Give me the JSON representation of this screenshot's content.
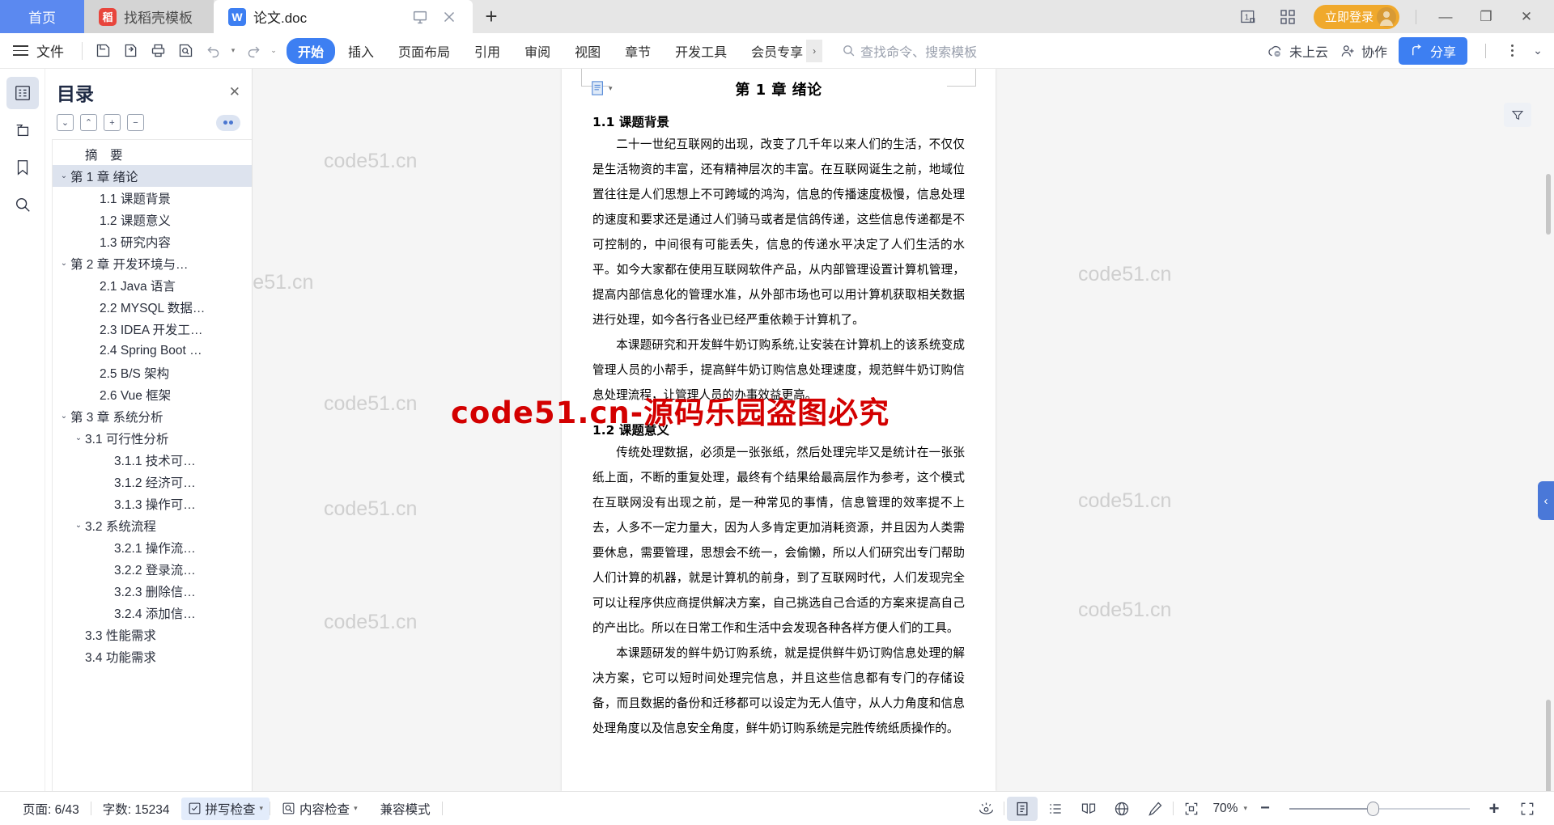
{
  "tabbar": {
    "tabs": [
      {
        "label": "首页",
        "icon": "",
        "type": "home"
      },
      {
        "label": "找稻壳模板",
        "icon": "docer-icon",
        "type": "docer"
      },
      {
        "label": "论文.doc",
        "icon": "wps-writer-icon",
        "type": "doc"
      }
    ],
    "doc_tab_actions": [
      "present-icon",
      "close-icon"
    ],
    "new_tab": "+",
    "right": {
      "page_count_icon": "1",
      "grid_icon": "apps-grid-icon",
      "login_label": "立即登录",
      "minimize": "—",
      "restore": "❐",
      "close": "✕"
    }
  },
  "ribbon": {
    "file_label": "文件",
    "quick_access": [
      "save-icon",
      "save-as-cloud-icon",
      "print-icon",
      "print-preview-icon",
      "undo-icon",
      "redo-icon"
    ],
    "tabs": [
      {
        "label": "开始",
        "active": true
      },
      {
        "label": "插入",
        "active": false
      },
      {
        "label": "页面布局",
        "active": false
      },
      {
        "label": "引用",
        "active": false
      },
      {
        "label": "审阅",
        "active": false
      },
      {
        "label": "视图",
        "active": false
      },
      {
        "label": "章节",
        "active": false
      },
      {
        "label": "开发工具",
        "active": false
      },
      {
        "label": "会员专享",
        "active": false
      }
    ],
    "search_placeholder": "查找命令、搜索模板",
    "cloud_label": "未上云",
    "collab_label": "协作",
    "share_label": "分享"
  },
  "rail": {
    "items": [
      {
        "name": "outline-icon",
        "active": true
      },
      {
        "name": "pages-thumbnail-icon",
        "active": false
      },
      {
        "name": "bookmark-icon",
        "active": false
      },
      {
        "name": "search-icon",
        "active": false
      }
    ]
  },
  "navpane": {
    "title": "目录",
    "close": "✕",
    "tools": [
      "collapse-down",
      "collapse-up",
      "expand-plus",
      "collapse-minus"
    ],
    "toc": [
      {
        "label": "摘　要",
        "indent": 1,
        "chev": "",
        "selected": false
      },
      {
        "label": "第 1 章 绪论",
        "indent": 0,
        "chev": "v",
        "selected": true
      },
      {
        "label": "1.1 课题背景",
        "indent": 2,
        "chev": "",
        "selected": false
      },
      {
        "label": "1.2 课题意义",
        "indent": 2,
        "chev": "",
        "selected": false
      },
      {
        "label": "1.3 研究内容",
        "indent": 2,
        "chev": "",
        "selected": false
      },
      {
        "label": "第 2 章 开发环境与…",
        "indent": 0,
        "chev": "v",
        "selected": false
      },
      {
        "label": "2.1 Java 语言",
        "indent": 2,
        "chev": "",
        "selected": false
      },
      {
        "label": "2.2 MYSQL 数据…",
        "indent": 2,
        "chev": "",
        "selected": false
      },
      {
        "label": "2.3 IDEA 开发工…",
        "indent": 2,
        "chev": "",
        "selected": false
      },
      {
        "label": "2.4 Spring Boot …",
        "indent": 2,
        "chev": "",
        "selected": false
      },
      {
        "label": "2.5 B/S 架构",
        "indent": 2,
        "chev": "",
        "selected": false
      },
      {
        "label": "2.6 Vue 框架",
        "indent": 2,
        "chev": "",
        "selected": false
      },
      {
        "label": "第 3 章 系统分析",
        "indent": 0,
        "chev": "v",
        "selected": false
      },
      {
        "label": "3.1 可行性分析",
        "indent": 1,
        "chev": "v",
        "selected": false
      },
      {
        "label": "3.1.1 技术可…",
        "indent": 3,
        "chev": "",
        "selected": false
      },
      {
        "label": "3.1.2 经济可…",
        "indent": 3,
        "chev": "",
        "selected": false
      },
      {
        "label": "3.1.3 操作可…",
        "indent": 3,
        "chev": "",
        "selected": false
      },
      {
        "label": "3.2 系统流程",
        "indent": 1,
        "chev": "v",
        "selected": false
      },
      {
        "label": "3.2.1 操作流…",
        "indent": 3,
        "chev": "",
        "selected": false
      },
      {
        "label": "3.2.2 登录流…",
        "indent": 3,
        "chev": "",
        "selected": false
      },
      {
        "label": "3.2.3 删除信…",
        "indent": 3,
        "chev": "",
        "selected": false
      },
      {
        "label": "3.2.4 添加信…",
        "indent": 3,
        "chev": "",
        "selected": false
      },
      {
        "label": "3.3 性能需求",
        "indent": 1,
        "chev": "",
        "selected": false
      },
      {
        "label": "3.4 功能需求",
        "indent": 1,
        "chev": "",
        "selected": false
      }
    ]
  },
  "document": {
    "heading": "第 1 章 绪论",
    "sections": [
      {
        "heading": "1.1  课题背景",
        "paragraphs": [
          "二十一世纪互联网的出现，改变了几千年以来人们的生活，不仅仅是生活物资的丰富，还有精神层次的丰富。在互联网诞生之前，地域位置往往是人们思想上不可跨域的鸿沟，信息的传播速度极慢，信息处理的速度和要求还是通过人们骑马或者是信鸽传递，这些信息传递都是不可控制的，中间很有可能丢失，信息的传递水平决定了人们生活的水平。如今大家都在使用互联网软件产品，从内部管理设置计算机管理，提高内部信息化的管理水准，从外部市场也可以用计算机获取相关数据进行处理，如今各行各业已经严重依赖于计算机了。",
          "本课题研究和开发鲜牛奶订购系统,让安装在计算机上的该系统变成管理人员的小帮手，提高鲜牛奶订购信息处理速度，规范鲜牛奶订购信息处理流程，让管理人员的办事效益更高。"
        ]
      },
      {
        "heading": "1.2  课题意义",
        "paragraphs": [
          "传统处理数据，必须是一张张纸，然后处理完毕又是统计在一张张纸上面，不断的重复处理，最终有个结果给最高层作为参考，这个模式在互联网没有出现之前，是一种常见的事情，信息管理的效率提不上去，人多不一定力量大，因为人多肯定更加消耗资源，并且因为人类需要休息，需要管理，思想会不统一，会偷懒，所以人们研究出专门帮助人们计算的机器，就是计算机的前身，到了互联网时代，人们发现完全可以让程序供应商提供解决方案，自己挑选自己合适的方案来提高自己的产出比。所以在日常工作和生活中会发现各种各样方便人们的工具。",
          "本课题研发的鲜牛奶订购系统，就是提供鲜牛奶订购信息处理的解决方案，它可以短时间处理完信息，并且这些信息都有专门的存储设备，而且数据的备份和迁移都可以设定为无人值守，从人力角度和信息处理角度以及信息安全角度，鲜牛奶订购系统是完胜传统纸质操作的。"
        ]
      }
    ],
    "watermark_text": "code51.cn",
    "big_watermark": "code51.cn-源码乐园盗图必究"
  },
  "status": {
    "page_label": "页面: 6/43",
    "word_count_label": "字数: 15234",
    "spell_check_label": "拼写检查",
    "content_check_label": "内容检查",
    "compat_mode_label": "兼容模式",
    "view_icons": [
      "focus-eye-icon",
      "page-view-icon",
      "outline-view-icon",
      "read-view-icon",
      "web-view-icon",
      "edit-pen-icon"
    ],
    "fit_icon": "fit-page-icon",
    "zoom_value": "70%",
    "zoom_out": "−",
    "zoom_in": "+",
    "fullscreen_icon": "fullscreen-icon"
  }
}
